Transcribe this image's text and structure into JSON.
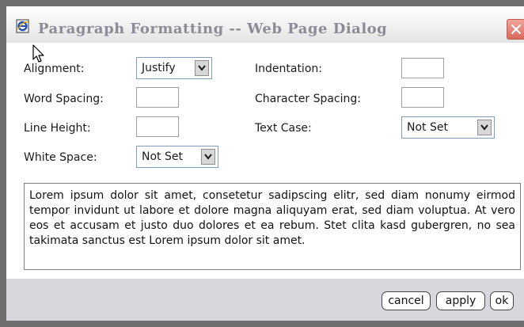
{
  "dialog": {
    "title": "Paragraph Formatting -- Web Page Dialog",
    "title_icon": "ie-icon",
    "close_icon": "close-icon"
  },
  "fields": {
    "alignment": {
      "label": "Alignment:",
      "value": "Justify"
    },
    "indentation": {
      "label": "Indentation:",
      "value": ""
    },
    "word_spacing": {
      "label": "Word Spacing:",
      "value": ""
    },
    "character_spacing": {
      "label": "Character Spacing:",
      "value": ""
    },
    "line_height": {
      "label": "Line Height:",
      "value": ""
    },
    "text_case": {
      "label": "Text Case:",
      "value": "Not Set"
    },
    "white_space": {
      "label": "White Space:",
      "value": "Not Set"
    }
  },
  "preview": {
    "text": "Lorem ipsum dolor sit amet, consetetur sadipscing elitr, sed diam nonumy eirmod tempor invidunt ut labore et dolore magna aliquyam erat, sed diam voluptua. At vero eos et accusam et justo duo dolores et ea rebum. Stet clita kasd gubergren, no sea takimata sanctus est Lorem ipsum dolor sit amet."
  },
  "buttons": {
    "cancel": "cancel",
    "apply": "apply",
    "ok": "ok"
  },
  "colors": {
    "title_text": "#8c8c99",
    "footer_bg": "#d7d7dd",
    "close_button": "#d9695b"
  }
}
